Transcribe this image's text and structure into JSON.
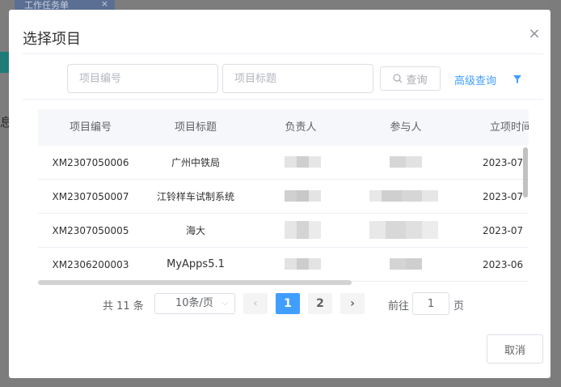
{
  "background": {
    "tab_label": "工作任务单",
    "tab_close": "×",
    "side_glyph": "息"
  },
  "dialog": {
    "title": "选择项目",
    "close": "×",
    "filters": {
      "code_placeholder": "项目编号",
      "title_placeholder": "项目标题",
      "search_label": "查询",
      "advanced_label": "高级查询"
    },
    "table": {
      "columns": [
        "项目编号",
        "项目标题",
        "负责人",
        "参与人",
        "立项时间"
      ],
      "rows": [
        {
          "code": "XM2307050006",
          "title": "广州中铁局",
          "date": "2023-07"
        },
        {
          "code": "XM2307050007",
          "title": "江铃样车试制系统",
          "date": "2023-07"
        },
        {
          "code": "XM2307050005",
          "title": "海大",
          "date": "2023-07"
        },
        {
          "code": "XM2306200003",
          "title": "MyApps5.1",
          "date": "2023-06"
        }
      ]
    },
    "pagination": {
      "total_text": "共 11 条",
      "page_size": "10条/页",
      "prev": "‹",
      "next": "›",
      "pages": [
        "1",
        "2"
      ],
      "current_page": 1,
      "goto_label": "前往",
      "goto_value": "1",
      "page_unit": "页"
    },
    "cancel_label": "取消"
  }
}
